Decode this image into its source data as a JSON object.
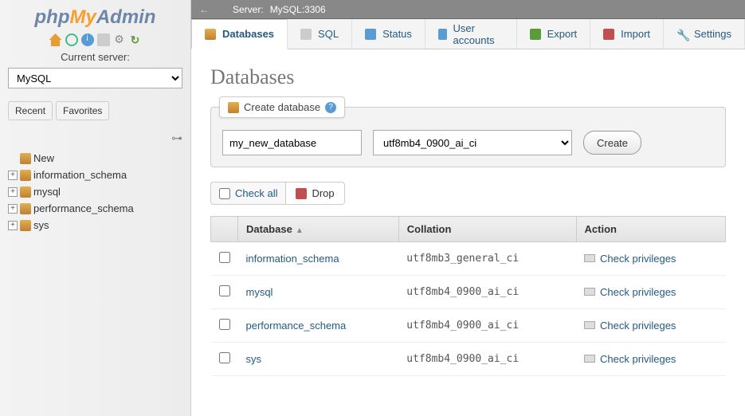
{
  "logo": {
    "part1": "php",
    "part2": "My",
    "part3": "Admin"
  },
  "sidebar": {
    "server_label": "Current server:",
    "server_value": "MySQL",
    "tabs": {
      "recent": "Recent",
      "favorites": "Favorites"
    },
    "new_label": "New",
    "items": [
      {
        "label": "information_schema"
      },
      {
        "label": "mysql"
      },
      {
        "label": "performance_schema"
      },
      {
        "label": "sys"
      }
    ]
  },
  "breadcrumb": {
    "server_label": "Server:",
    "server_value": "MySQL:3306"
  },
  "topnav": {
    "databases": "Databases",
    "sql": "SQL",
    "status": "Status",
    "users": "User accounts",
    "export": "Export",
    "import": "Import",
    "settings": "Settings"
  },
  "page_title": "Databases",
  "create": {
    "legend": "Create database",
    "db_name_value": "my_new_database",
    "collation_value": "utf8mb4_0900_ai_ci",
    "button": "Create"
  },
  "bulk": {
    "check_all": "Check all",
    "drop": "Drop"
  },
  "table": {
    "headers": {
      "database": "Database",
      "collation": "Collation",
      "action": "Action"
    },
    "rows": [
      {
        "name": "information_schema",
        "collation": "utf8mb3_general_ci",
        "action": "Check privileges"
      },
      {
        "name": "mysql",
        "collation": "utf8mb4_0900_ai_ci",
        "action": "Check privileges"
      },
      {
        "name": "performance_schema",
        "collation": "utf8mb4_0900_ai_ci",
        "action": "Check privileges"
      },
      {
        "name": "sys",
        "collation": "utf8mb4_0900_ai_ci",
        "action": "Check privileges"
      }
    ]
  }
}
